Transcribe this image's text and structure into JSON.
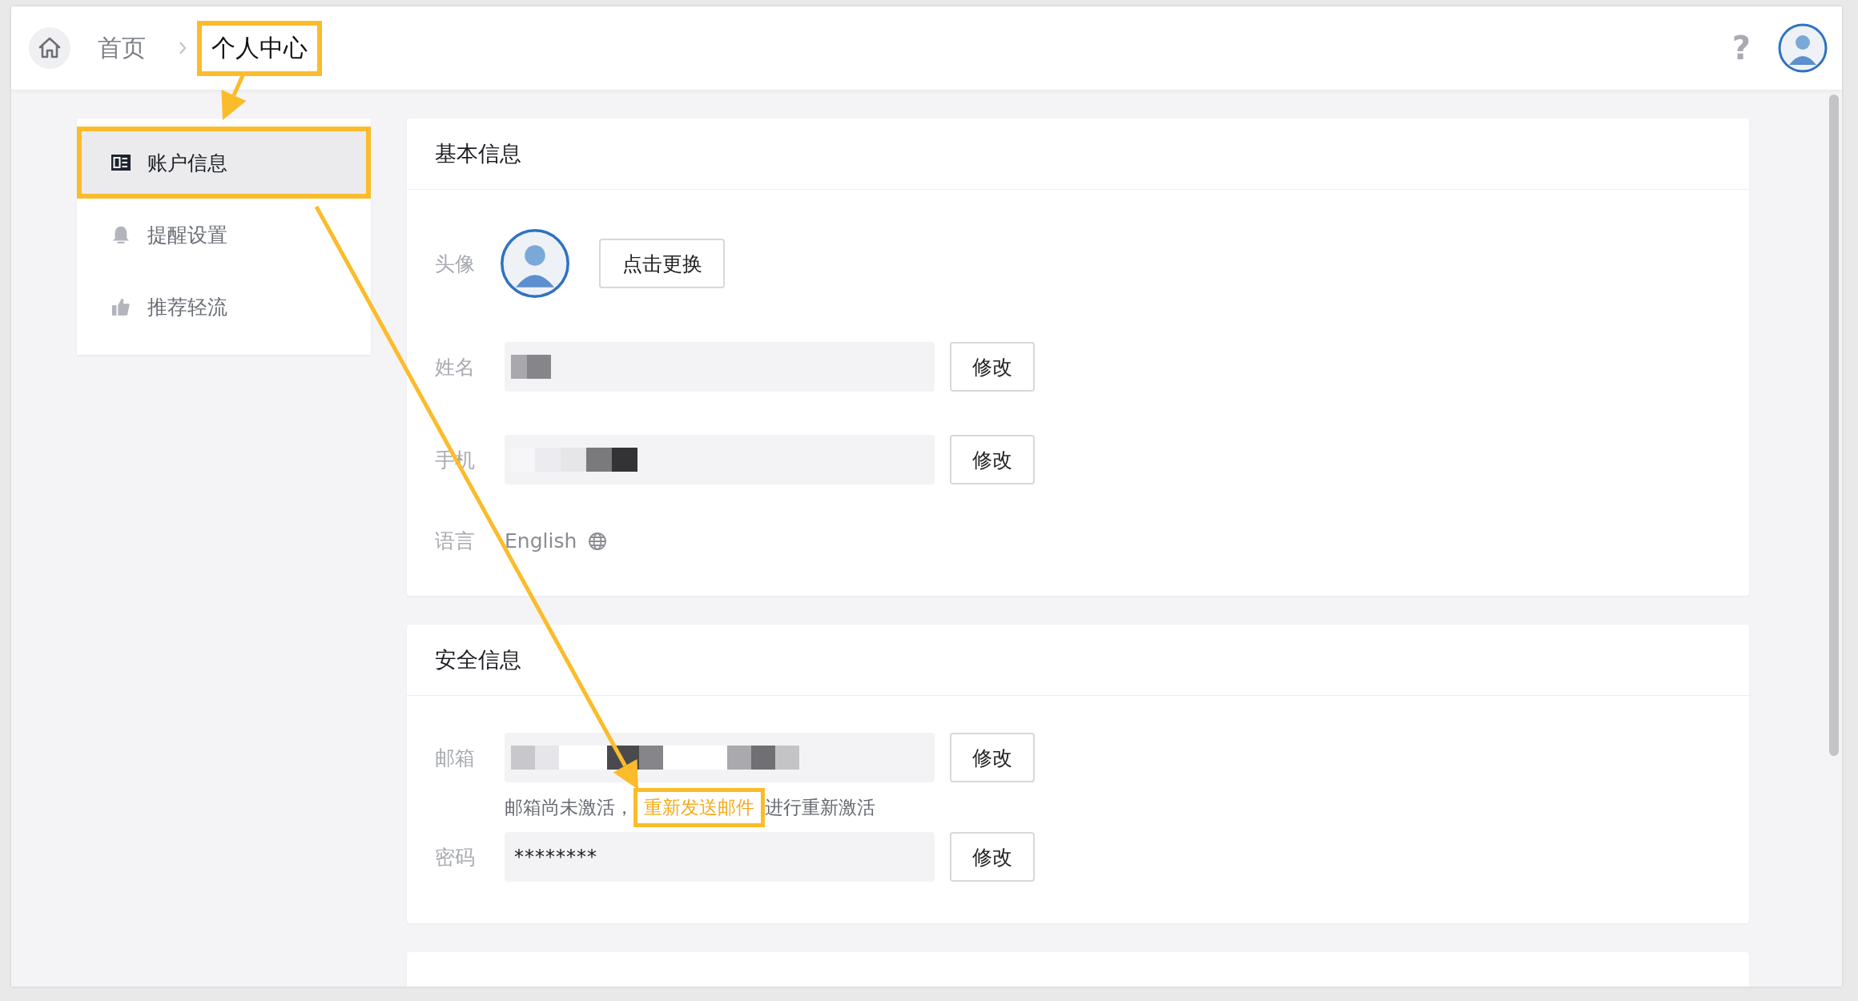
{
  "header": {
    "breadcrumb": [
      {
        "label": "首页",
        "current": false,
        "highlighted": false
      },
      {
        "label": "个人中心",
        "current": true,
        "highlighted": true
      }
    ],
    "help": "?"
  },
  "sidebar": {
    "items": [
      {
        "label": "账户信息",
        "selected": true,
        "highlighted": true
      },
      {
        "label": "提醒设置",
        "selected": false,
        "highlighted": false
      },
      {
        "label": "推荐轻流",
        "selected": false,
        "highlighted": false
      }
    ]
  },
  "sections": [
    {
      "title": "基本信息",
      "rows": [
        {
          "kind": "avatar",
          "label": "头像",
          "button": "点击更换"
        },
        {
          "kind": "field",
          "label": "姓名",
          "redacted": true,
          "button": "修改"
        },
        {
          "kind": "field",
          "label": "手机",
          "redacted": true,
          "button": "修改"
        },
        {
          "kind": "language",
          "label": "语言",
          "value": "English"
        }
      ]
    },
    {
      "title": "安全信息",
      "rows": [
        {
          "kind": "field",
          "label": "邮箱",
          "redacted": true,
          "button": "修改"
        },
        {
          "kind": "hint",
          "before": "邮箱尚未激活，",
          "link": "重新发送邮件",
          "after": "进行重新激活",
          "highlighted": true
        },
        {
          "kind": "field",
          "label": "密码",
          "redacted": false,
          "value": "********",
          "button": "修改"
        }
      ]
    },
    {
      "kind": "cut-off"
    }
  ]
}
